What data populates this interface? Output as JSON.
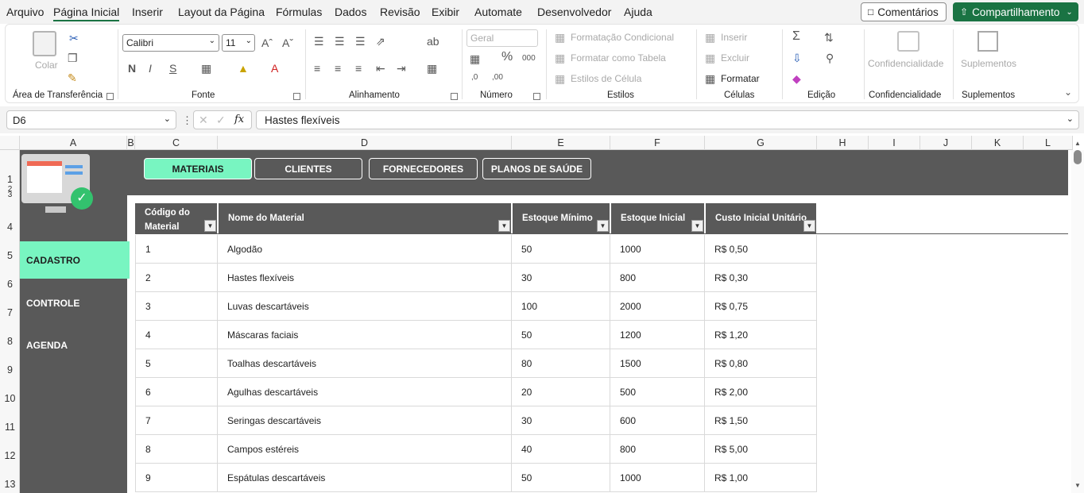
{
  "menu": {
    "items": [
      "Arquivo",
      "Página Inicial",
      "Inserir",
      "Layout da Página",
      "Fórmulas",
      "Dados",
      "Revisão",
      "Exibir",
      "Automate",
      "Desenvolvedor",
      "Ajuda"
    ],
    "active": "Página Inicial",
    "comments_label": "Comentários",
    "share_label": "Compartilhamento"
  },
  "ribbon": {
    "clipboard": {
      "label": "Área de Transferência",
      "paste": "Colar"
    },
    "font": {
      "label": "Fonte",
      "font_name": "Calibri",
      "font_size": "11"
    },
    "alignment": {
      "label": "Alinhamento"
    },
    "number": {
      "label": "Número",
      "format": "Geral"
    },
    "styles": {
      "label": "Estilos",
      "conditional": "Formatação Condicional",
      "as_table": "Formatar como Tabela",
      "cell_styles": "Estilos de Célula"
    },
    "cells": {
      "label": "Células",
      "insert": "Inserir",
      "delete": "Excluir",
      "format": "Formatar"
    },
    "editing": {
      "label": "Edição"
    },
    "sensitivity": {
      "label": "Confidencialidade",
      "button": "Confidencialidade"
    },
    "addins": {
      "label": "Suplementos",
      "button": "Suplementos"
    }
  },
  "formula_bar": {
    "cell_ref": "D6",
    "fx": "fx",
    "content": "Hastes flexíveis"
  },
  "columns": [
    "A",
    "B",
    "C",
    "D",
    "E",
    "F",
    "G",
    "H",
    "I",
    "J",
    "K",
    "L"
  ],
  "rows": [
    "1",
    "2",
    "3",
    "4",
    "5",
    "6",
    "7",
    "8",
    "9",
    "10",
    "11",
    "12",
    "13"
  ],
  "top_tabs": [
    "MATERIAIS",
    "CLIENTES",
    "FORNECEDORES",
    "PLANOS DE SAÚDE"
  ],
  "active_tab": "MATERIAIS",
  "side_menu": [
    "CADASTRO",
    "CONTROLE",
    "AGENDA"
  ],
  "active_side": "CADASTRO",
  "table": {
    "headers": [
      "Código do Material",
      "Nome do Material",
      "Estoque Mínimo",
      "Estoque Inicial",
      "Custo Inicial Unitário"
    ],
    "rows": [
      [
        "1",
        "Algodão",
        "50",
        "1000",
        "R$ 0,50"
      ],
      [
        "2",
        "Hastes flexíveis",
        "30",
        "800",
        "R$ 0,30"
      ],
      [
        "3",
        "Luvas descartáveis",
        "100",
        "2000",
        "R$ 0,75"
      ],
      [
        "4",
        "Máscaras faciais",
        "50",
        "1200",
        "R$ 1,20"
      ],
      [
        "5",
        "Toalhas descartáveis",
        "80",
        "1500",
        "R$ 0,80"
      ],
      [
        "6",
        "Agulhas descartáveis",
        "20",
        "500",
        "R$ 2,00"
      ],
      [
        "7",
        "Seringas descartáveis",
        "30",
        "600",
        "R$ 1,50"
      ],
      [
        "8",
        "Campos estéreis",
        "40",
        "800",
        "R$ 5,00"
      ],
      [
        "9",
        "Espátulas descartáveis",
        "50",
        "1000",
        "R$ 1,00"
      ]
    ]
  },
  "colors": {
    "accent": "#78f5c1",
    "panel": "#595959",
    "share": "#1a7343"
  }
}
